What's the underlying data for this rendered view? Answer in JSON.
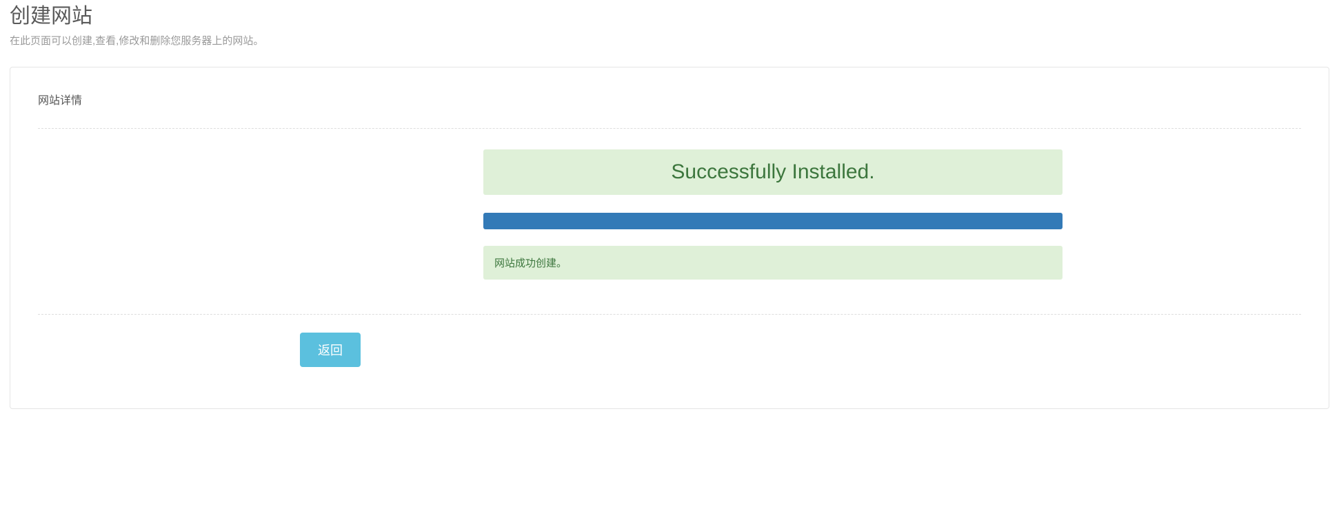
{
  "header": {
    "title": "创建网站",
    "subtitle": "在此页面可以创建,查看,修改和删除您服务器上的网站。"
  },
  "panel": {
    "section_title": "网站详情",
    "success_banner": "Successfully Installed.",
    "progress_percent": 100,
    "created_message": "网站成功创建。",
    "back_button_label": "返回"
  }
}
